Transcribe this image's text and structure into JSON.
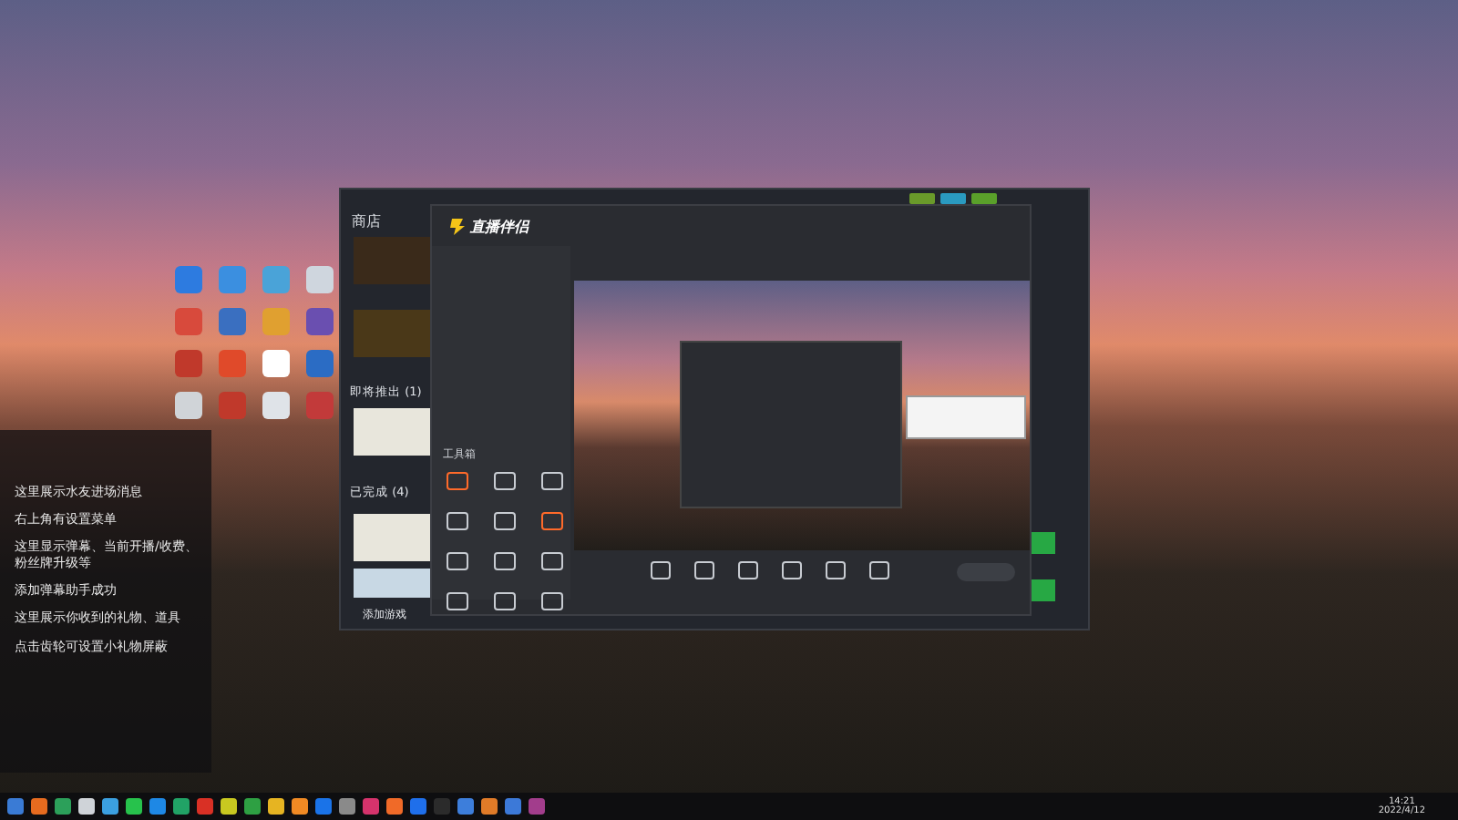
{
  "chat_panel": {
    "messages": [
      {
        "text": "这里展示水友进场消息"
      },
      {
        "text": "右上角有设置菜单"
      },
      {
        "text": "这里显示弹幕、当前开播/收费、粉丝牌升级等"
      },
      {
        "text": "添加弹幕助手成功"
      },
      {
        "text": "这里展示你收到的礼物、道具"
      },
      {
        "text": "点击齿轮可设置小礼物屏蔽"
      }
    ]
  },
  "library_window": {
    "nav": "商店",
    "sections": [
      {
        "title": "即将推出 (1)"
      },
      {
        "title": "已完成 (4)"
      }
    ],
    "add_game": "添加游戏"
  },
  "live_app": {
    "brand": "直播伴侣",
    "toolbox": "工具箱"
  },
  "taskbar": {
    "time": "14:21",
    "date": "2022/4/12"
  }
}
